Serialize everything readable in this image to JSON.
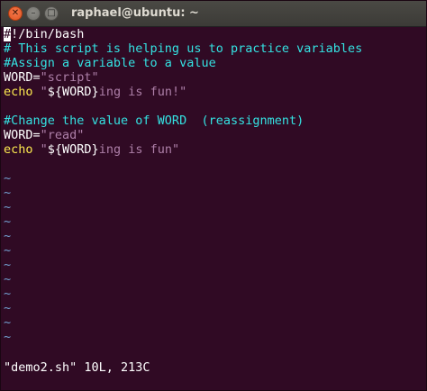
{
  "window": {
    "title": "raphael@ubuntu: ~",
    "close_glyph": "✕",
    "minimize_glyph": "–",
    "maximize_glyph": "□"
  },
  "colors": {
    "background": "#300a24",
    "comment": "#34e2e2",
    "string": "#ad7fa8",
    "keyword": "#fce94f",
    "tilde": "#729fcf"
  },
  "editor": {
    "cursor_char": "#",
    "line1_rest": "!/bin/bash",
    "line2": "# This script is helping us to practice variables",
    "line3": "#Assign a variable to a value",
    "line4_name": "WORD=",
    "line4_value": "\"script\"",
    "line5_kw": "echo",
    "line5_open": " \"",
    "line5_var": "${WORD}",
    "line5_rest": "ing is fun!\"",
    "line6": "",
    "line7": "#Change the value of WORD  (reassignment)",
    "line8_name": "WORD=",
    "line8_value": "\"read\"",
    "line9_kw": "echo",
    "line9_open": " \"",
    "line9_var": "${WORD}",
    "line9_rest": "ing is fun\"",
    "line10": "",
    "tilde": "~"
  },
  "status_line": "\"demo2.sh\" 10L, 213C"
}
